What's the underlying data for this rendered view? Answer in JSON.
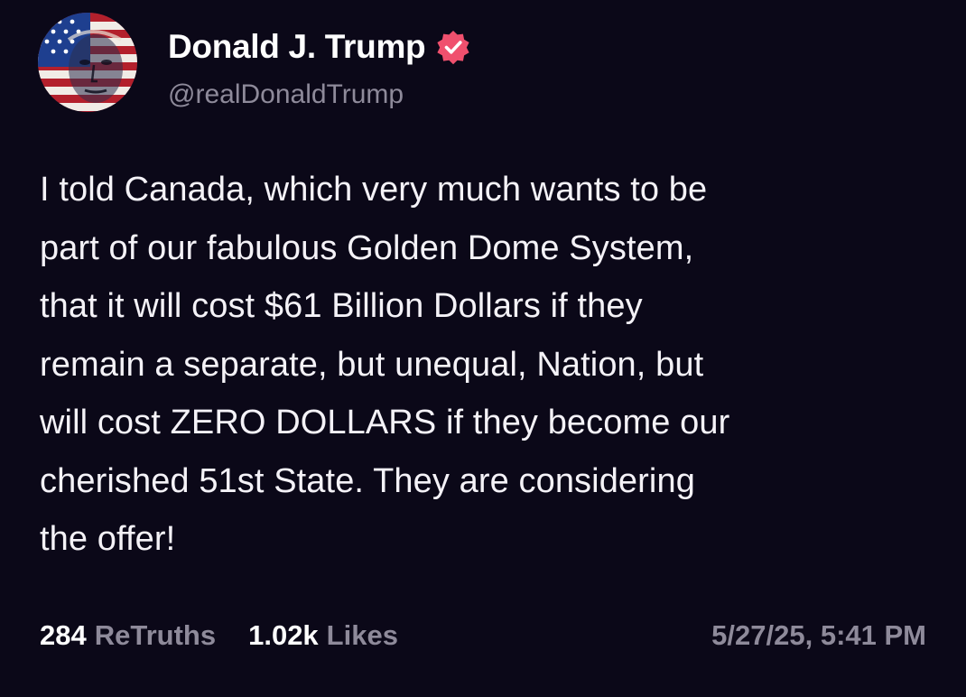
{
  "author": {
    "display_name": "Donald J. Trump",
    "handle": "@realDonaldTrump",
    "verified": true,
    "avatar_icon": "flag-portrait-avatar",
    "verified_icon": "verified-badge-icon"
  },
  "post": {
    "text_lines": [
      "I told Canada, which very much wants to be",
      "part of our fabulous Golden Dome System,",
      "that it will cost $61 Billion Dollars if they",
      "remain a separate, but unequal, Nation, but",
      "will cost ZERO DOLLARS if they become our",
      "cherished 51st State. They are considering",
      "the offer!"
    ]
  },
  "stats": {
    "retruths_count": "284",
    "retruths_label": "ReTruths",
    "likes_count": "1.02k",
    "likes_label": "Likes"
  },
  "timestamp": "5/27/25, 5:41 PM",
  "colors": {
    "background": "#0b0818",
    "text": "#ffffff",
    "muted": "#8e8a9a",
    "verified_badge": "#f0506e"
  }
}
